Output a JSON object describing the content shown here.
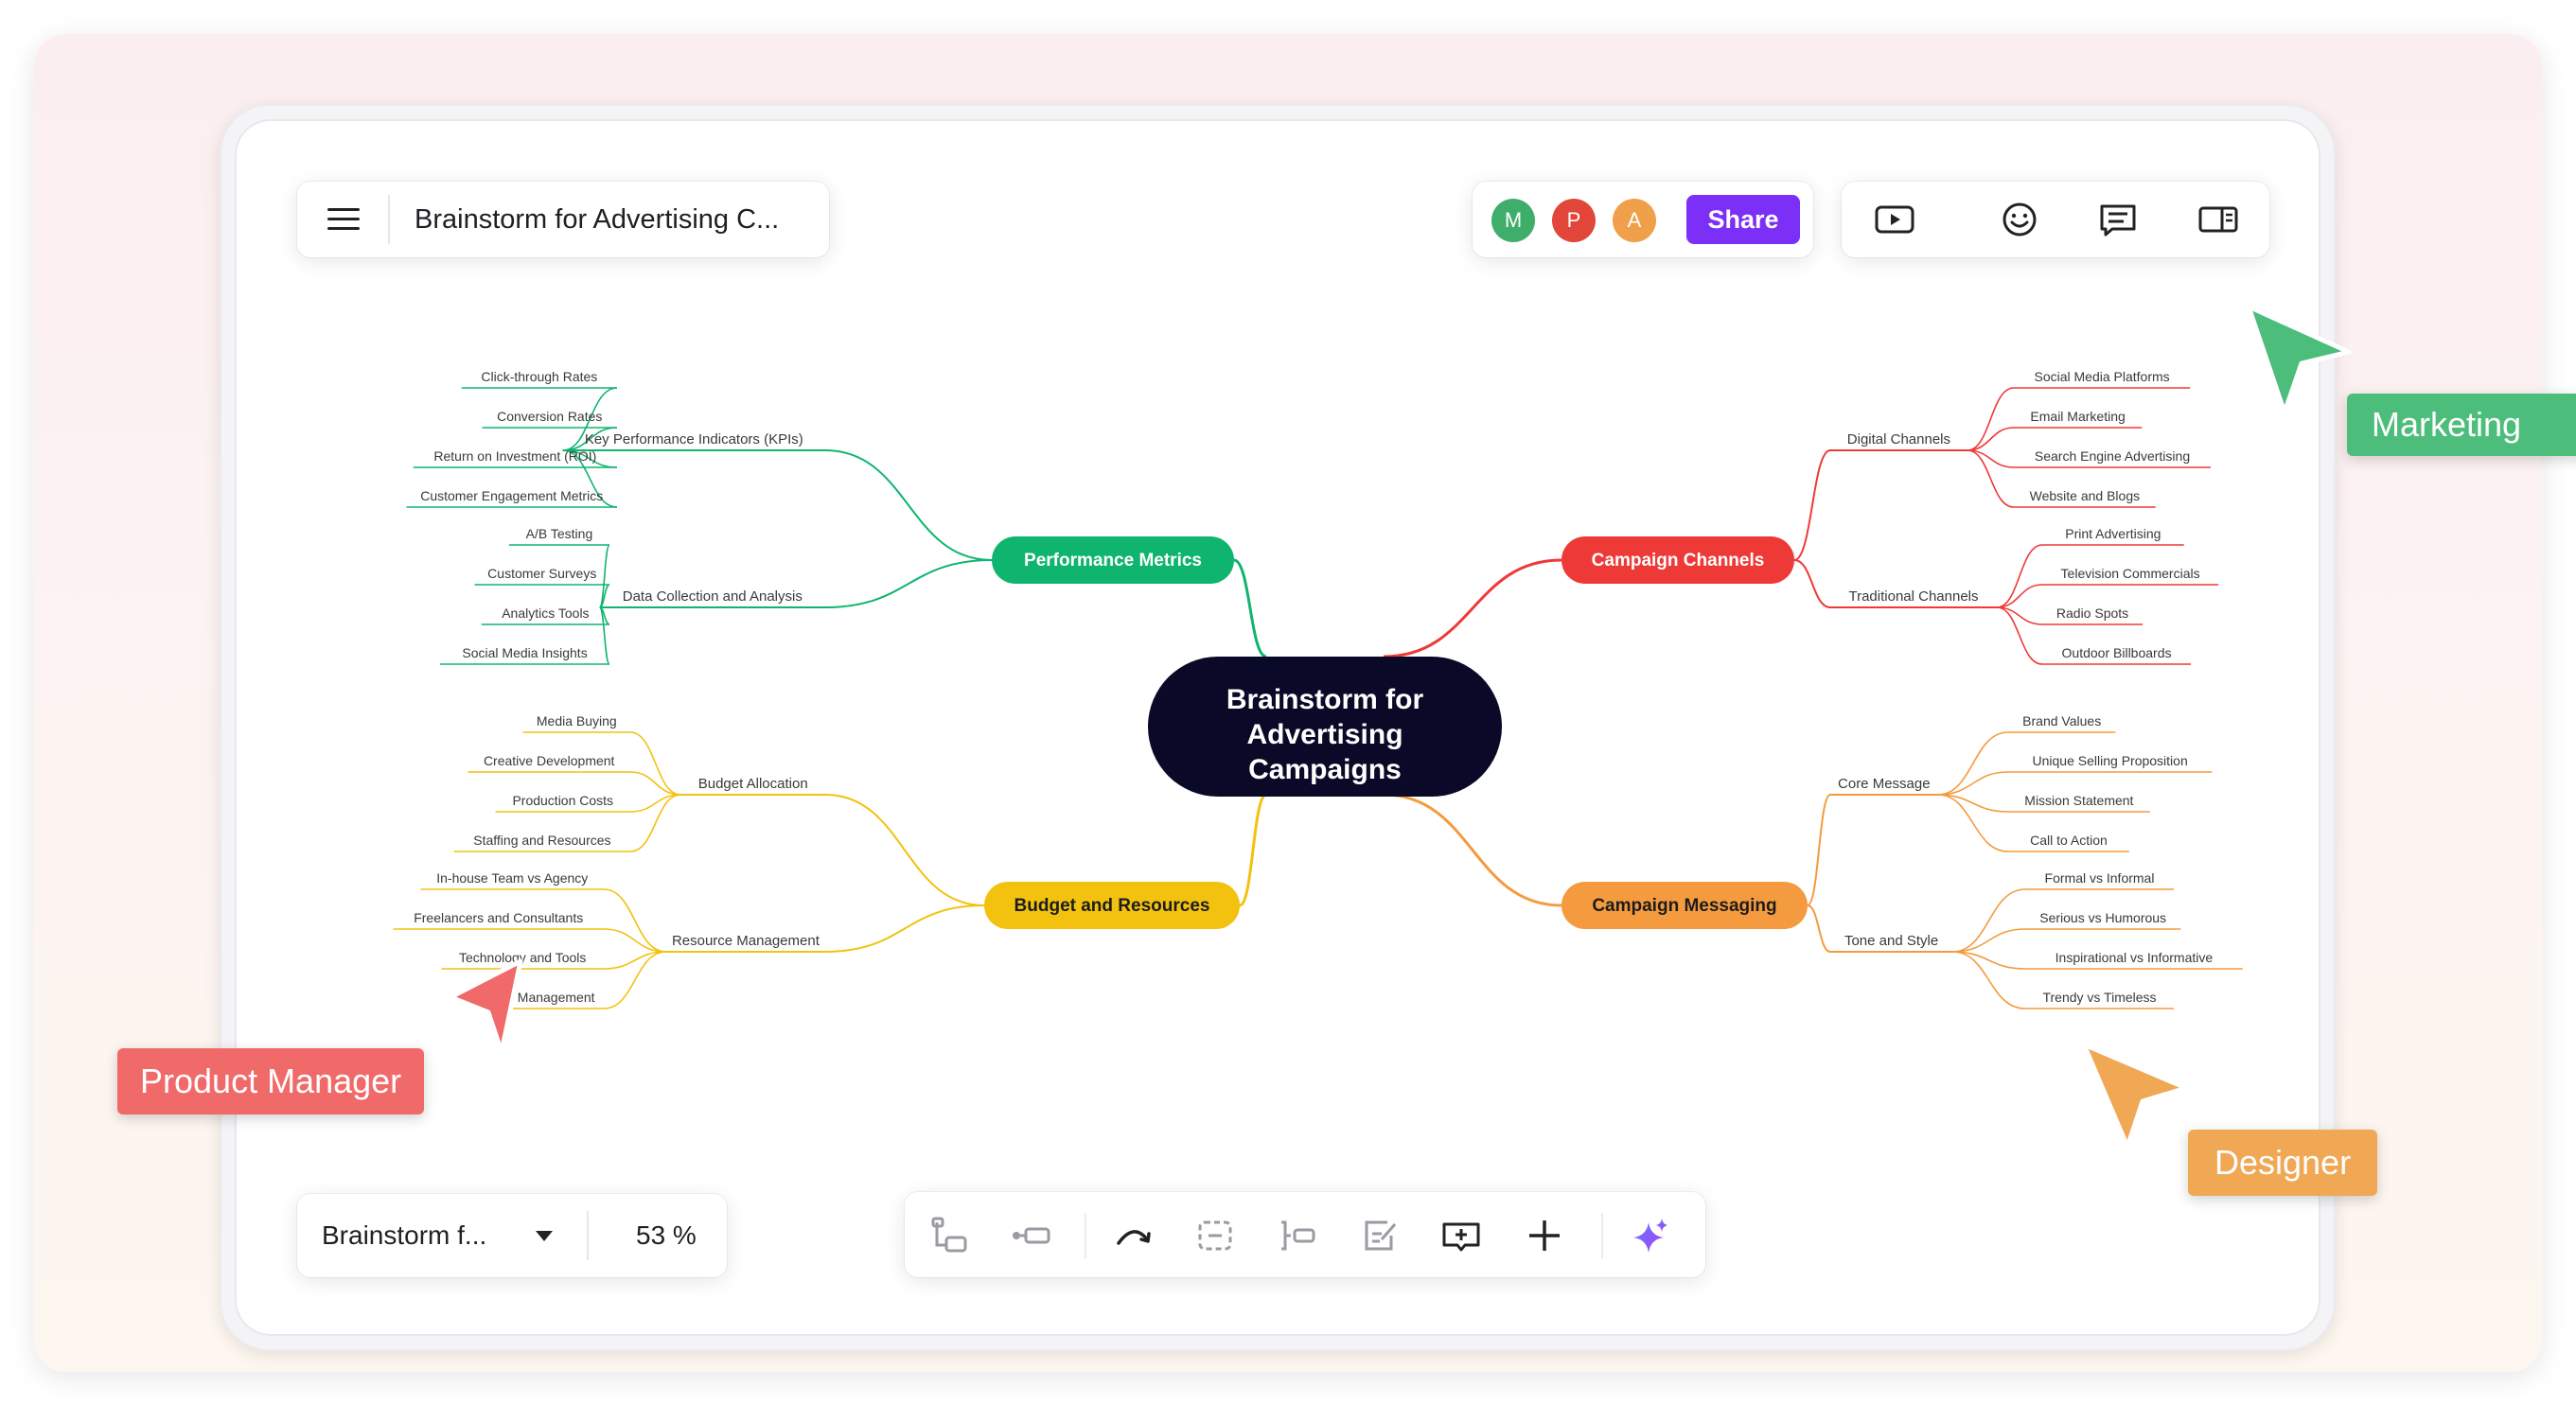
{
  "header": {
    "title": "Brainstorm for Advertising C...",
    "menu_icon": "hamburger-menu-icon"
  },
  "collaborators": [
    {
      "initial": "M",
      "color": "#3fae6a"
    },
    {
      "initial": "P",
      "color": "#e2453a"
    },
    {
      "initial": "A",
      "color": "#f0a04b"
    }
  ],
  "share_label": "Share",
  "toolbar_right": [
    "present-icon",
    "emoji-icon",
    "comment-icon",
    "sidebar-panel-icon"
  ],
  "bottom_left": {
    "sheet_name": "Brainstorm f...",
    "zoom": "53 %"
  },
  "bottom_toolbar": [
    "add-child-node-icon",
    "add-sibling-node-icon",
    "relationship-icon",
    "summary-icon",
    "boundary-icon",
    "note-icon",
    "insert-topic-icon",
    "add-icon",
    "ai-sparkle-icon"
  ],
  "mindmap": {
    "central": [
      "Brainstorm for",
      "Advertising",
      "Campaigns"
    ],
    "branches": [
      {
        "label": "Performance Metrics",
        "color": "#0fb56e",
        "groups": [
          {
            "label": "Key Performance Indicators (KPIs)",
            "leaves": [
              "Click-through Rates",
              "Conversion Rates",
              "Return on Investment (ROI)",
              "Customer Engagement Metrics"
            ]
          },
          {
            "label": "Data Collection and Analysis",
            "leaves": [
              "A/B Testing",
              "Customer Surveys",
              "Analytics Tools",
              "Social Media Insights"
            ]
          }
        ]
      },
      {
        "label": "Budget and Resources",
        "color": "#f2c20f",
        "groups": [
          {
            "label": "Budget Allocation",
            "leaves": [
              "Media Buying",
              "Creative Development",
              "Production Costs",
              "Staffing and Resources"
            ]
          },
          {
            "label": "Resource Management",
            "leaves": [
              "In-house Team vs Agency",
              "Freelancers and Consultants",
              "Technology and Tools",
              "Time Management"
            ]
          }
        ]
      },
      {
        "label": "Campaign Channels",
        "color": "#ee3a37",
        "groups": [
          {
            "label": "Digital Channels",
            "leaves": [
              "Social Media Platforms",
              "Email Marketing",
              "Search Engine Advertising",
              "Website and Blogs"
            ]
          },
          {
            "label": "Traditional Channels",
            "leaves": [
              "Print Advertising",
              "Television Commercials",
              "Radio Spots",
              "Outdoor Billboards"
            ]
          }
        ]
      },
      {
        "label": "Campaign Messaging",
        "color": "#f49b3f",
        "groups": [
          {
            "label": "Core Message",
            "leaves": [
              "Brand Values",
              "Unique Selling Proposition",
              "Mission Statement",
              "Call to Action"
            ]
          },
          {
            "label": "Tone and Style",
            "leaves": [
              "Formal vs Informal",
              "Serious vs Humorous",
              "Inspirational vs Informative",
              "Trendy vs Timeless"
            ]
          }
        ]
      }
    ]
  },
  "cursors": [
    {
      "name": "Marketing",
      "color": "#4dbd7c"
    },
    {
      "name": "Product Manager",
      "color": "#f06a6a"
    },
    {
      "name": "Designer",
      "color": "#f0a855"
    }
  ]
}
